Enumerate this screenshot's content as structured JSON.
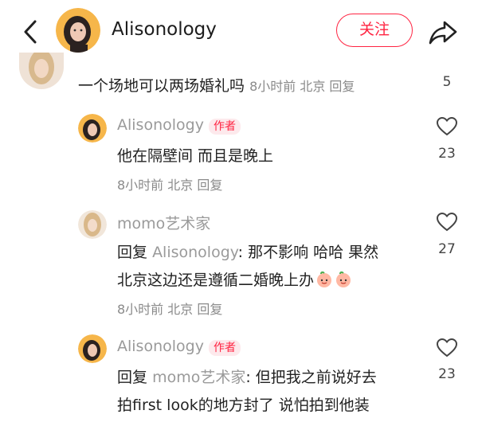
{
  "header": {
    "author_name": "Alisonology",
    "follow_label": "关注"
  },
  "comments": [
    {
      "text": "一个场地可以两场婚礼吗",
      "meta": "8小时前 北京 回复",
      "likes": "5"
    },
    {
      "user": "Alisonology",
      "badge": "作者",
      "text": "他在隔壁间 而且是晚上",
      "meta": "8小时前 北京 回复",
      "likes": "23"
    },
    {
      "user": "momo艺术家",
      "reply_prefix": "回复",
      "reply_to": "Alisonology",
      "text1": ": 那不影响 哈哈 果然",
      "text2": "北京这边还是遵循二婚晚上办",
      "meta": "8小时前 北京 回复",
      "likes": "27"
    },
    {
      "user": "Alisonology",
      "badge": "作者",
      "reply_prefix": "回复",
      "reply_to": "momo艺术家",
      "text1": ": 但把我之前说好去",
      "text2": "拍first look的地方封了 说怕拍到他装",
      "likes": "23"
    }
  ],
  "icons": {
    "back": "back-arrow-icon",
    "share": "share-icon",
    "heart": "heart-icon",
    "emoji": "peach-emoji-icon"
  },
  "colors": {
    "accent": "#ff2442",
    "muted": "#9a9a9a"
  }
}
